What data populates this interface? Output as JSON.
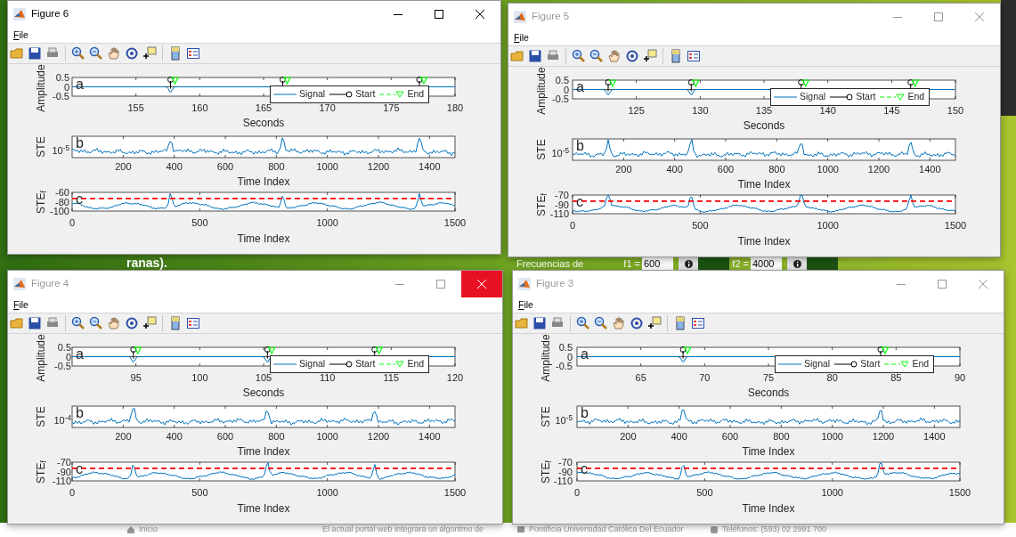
{
  "background": {
    "caption": "ranas).",
    "frequency_label": "Frecuencias de",
    "f1": {
      "label": "f1 =",
      "value": "600"
    },
    "f2": {
      "label": "f2 =",
      "value": "4000"
    },
    "footer": [
      "Inicio",
      "El actual portal web integrara un algoritmo de",
      "Pontificia Universidad Católica Del Ecuador",
      "Teléfonos: (593) 02 2991 700"
    ]
  },
  "windows": [
    {
      "title": "Figure 6",
      "active": true,
      "close_hovered": false,
      "menu": [
        "File"
      ],
      "panels": [
        {
          "kind": "signal",
          "letter": "a",
          "ylabel": "Amplitude",
          "yticks": [
            "0.5",
            "0",
            "-0.5"
          ],
          "xticks": [
            "155",
            "160",
            "165",
            "170",
            "175",
            "180"
          ],
          "xlabel": "Seconds",
          "legend": {
            "signal": "Signal",
            "start": "Start",
            "end": "End"
          }
        },
        {
          "kind": "energy",
          "letter": "b",
          "ylabel": "STE",
          "yticks": [
            "10$^{-5}$"
          ],
          "xticks": [
            "200",
            "400",
            "600",
            "800",
            "1000",
            "1200",
            "1400"
          ],
          "xlabel": "Time Index"
        },
        {
          "kind": "filtered",
          "letter": "c",
          "ylabel": "STE$_{f}$",
          "yticks": [
            "-60",
            "-80",
            "-100"
          ],
          "xticks": [
            "0",
            "500",
            "1000",
            "1500"
          ],
          "xlabel": "Time Index"
        }
      ]
    },
    {
      "title": "Figure 5",
      "active": false,
      "close_hovered": false,
      "menu": [
        "File"
      ],
      "panels": [
        {
          "kind": "signal",
          "letter": "a",
          "ylabel": "Amplitude",
          "yticks": [
            "0.5",
            "0",
            "-0.5"
          ],
          "xticks": [
            "125",
            "130",
            "135",
            "140",
            "145",
            "150"
          ],
          "xlabel": "Seconds",
          "legend": {
            "signal": "Signal",
            "start": "Start",
            "end": "End"
          }
        },
        {
          "kind": "energy",
          "letter": "b",
          "ylabel": "STE",
          "yticks": [
            "10$^{-5}$"
          ],
          "xticks": [
            "200",
            "400",
            "600",
            "800",
            "1000",
            "1200",
            "1400"
          ],
          "xlabel": "Time Index"
        },
        {
          "kind": "filtered",
          "letter": "c",
          "ylabel": "STE$_{f}$",
          "yticks": [
            "-70",
            "-90",
            "-110"
          ],
          "xticks": [
            "0",
            "500",
            "1000",
            "1500"
          ],
          "xlabel": "Time Index"
        }
      ]
    },
    {
      "title": "Figure 4",
      "active": false,
      "close_hovered": true,
      "menu": [
        "File"
      ],
      "panels": [
        {
          "kind": "signal",
          "letter": "a",
          "ylabel": "Amplitude",
          "yticks": [
            "0.5",
            "0",
            "-0.5"
          ],
          "xticks": [
            "95",
            "100",
            "105",
            "110",
            "115",
            "120"
          ],
          "xlabel": "Seconds",
          "legend": {
            "signal": "Signal",
            "start": "Start",
            "end": "End"
          }
        },
        {
          "kind": "energy",
          "letter": "b",
          "ylabel": "STE",
          "yticks": [
            "10$^{-4}$"
          ],
          "xticks": [
            "200",
            "400",
            "600",
            "800",
            "1000",
            "1200",
            "1400"
          ],
          "xlabel": "Time Index"
        },
        {
          "kind": "filtered",
          "letter": "c",
          "ylabel": "STE$_{f}$",
          "yticks": [
            "-70",
            "-90",
            "-110"
          ],
          "xticks": [
            "0",
            "500",
            "1000",
            "1500"
          ],
          "xlabel": "Time Index"
        }
      ]
    },
    {
      "title": "Figure 3",
      "active": false,
      "close_hovered": false,
      "menu": [
        "File"
      ],
      "panels": [
        {
          "kind": "signal",
          "letter": "a",
          "ylabel": "Amplitude",
          "yticks": [
            "0.5",
            "0",
            "-0.5"
          ],
          "xticks": [
            "65",
            "70",
            "75",
            "80",
            "85",
            "90"
          ],
          "xlabel": "Seconds",
          "legend": {
            "signal": "Signal",
            "start": "Start",
            "end": "End"
          }
        },
        {
          "kind": "energy",
          "letter": "b",
          "ylabel": "STE",
          "yticks": [
            "10$^{-5}$"
          ],
          "xticks": [
            "200",
            "400",
            "600",
            "800",
            "1000",
            "1200",
            "1400"
          ],
          "xlabel": "Time Index"
        },
        {
          "kind": "filtered",
          "letter": "c",
          "ylabel": "STE$_{f}$",
          "yticks": [
            "-70",
            "-90",
            "-110"
          ],
          "xticks": [
            "0",
            "500",
            "1000",
            "1500"
          ],
          "xlabel": "Time Index"
        }
      ]
    }
  ]
}
